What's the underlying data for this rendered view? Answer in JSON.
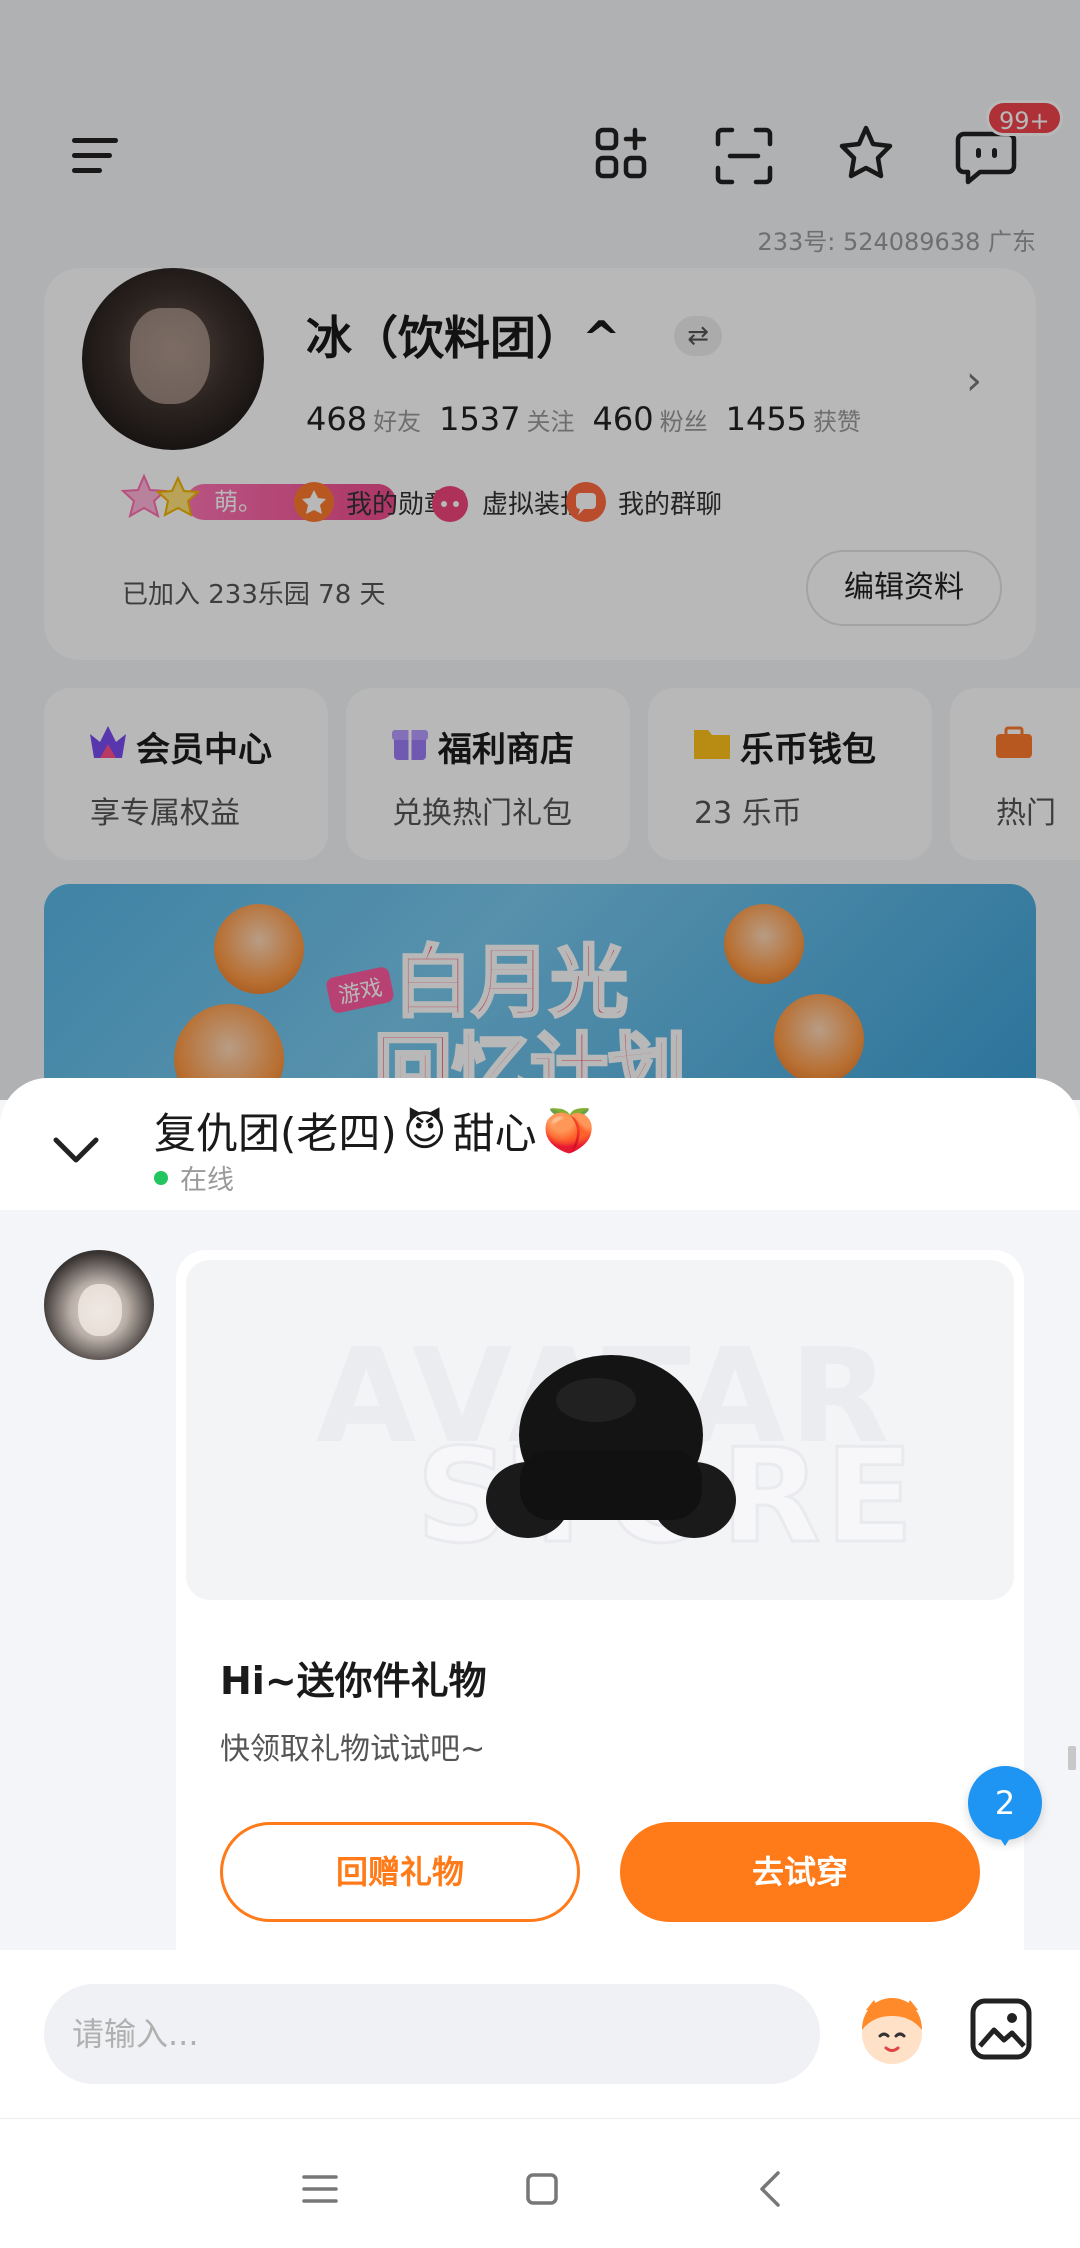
{
  "header": {
    "unread_badge": "99+",
    "id_line": "233号: 524089638   广东"
  },
  "profile": {
    "name": "冰（饮料团）^",
    "switch_glyph": "⇄",
    "stats": [
      {
        "num": "468",
        "label": "好友"
      },
      {
        "num": "1537",
        "label": "关注"
      },
      {
        "num": "460",
        "label": "粉丝"
      },
      {
        "num": "1455",
        "label": "获赞"
      }
    ],
    "vip_tag": "萌。",
    "quick_links": [
      "我的勋章",
      "虚拟装扮",
      "我的群聊"
    ],
    "joined": "已加入 233乐园 78 天",
    "edit_button": "编辑资料"
  },
  "tiles": [
    {
      "title": "会员中心",
      "sub": "享专属权益"
    },
    {
      "title": "福利商店",
      "sub": "兑换热门礼包"
    },
    {
      "title": "乐币钱包",
      "sub": "23 乐币"
    },
    {
      "title": "",
      "sub": "热门"
    }
  ],
  "banner": {
    "tag": "游戏",
    "line1": "白月光",
    "line2": "回忆计划"
  },
  "chat": {
    "title": "复仇团(老四)",
    "title_emoji_1": "😈",
    "title_suffix": "甜心",
    "title_emoji_2": "🍑",
    "status": "在线",
    "gift_watermark_1": "AVATAR",
    "gift_watermark_2": "STORE",
    "gift_title": "Hi~送你件礼物",
    "gift_desc": "快领取礼物试试吧~",
    "return_button": "回赠礼物",
    "try_button": "去试穿",
    "unread_count": "2",
    "input_placeholder": "请输入..."
  },
  "colors": {
    "accent": "#ff7a18",
    "online": "#22c55e",
    "bubble": "#1e95f2"
  },
  "icons": [
    "menu-icon",
    "apps-icon",
    "scan-icon",
    "star-badge-icon",
    "message-icon",
    "chevron-right-icon",
    "chevron-down-icon",
    "emoji-mascot-icon",
    "image-icon",
    "nav-menu-icon",
    "nav-home-icon",
    "nav-back-icon"
  ]
}
